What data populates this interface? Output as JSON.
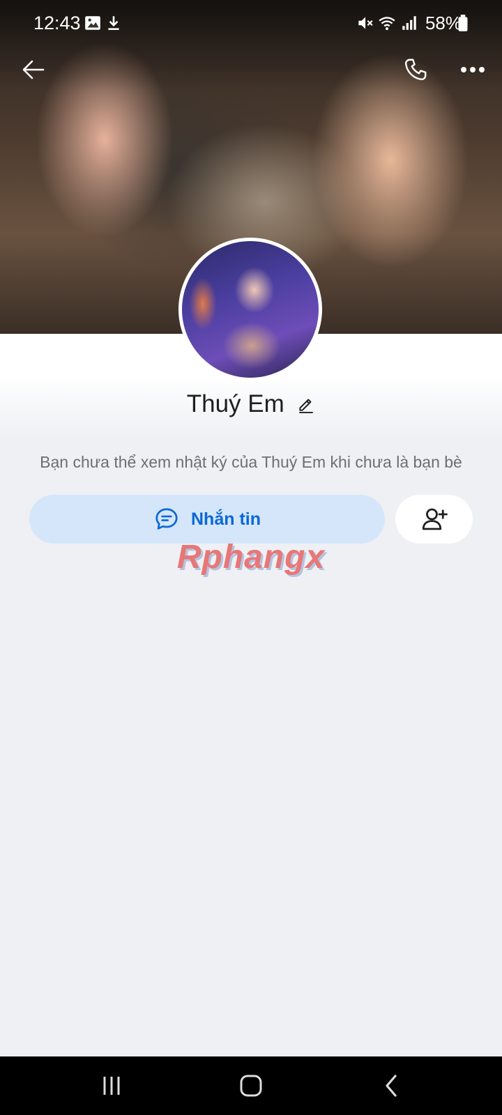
{
  "status": {
    "time": "12:43",
    "battery": "58%",
    "icons": [
      "image-icon",
      "download-icon",
      "mute-icon",
      "wifi-icon",
      "signal-icon",
      "battery-icon"
    ]
  },
  "topbar": {
    "back_icon": "back-arrow-icon",
    "call_icon": "phone-icon",
    "more_icon": "more-dots-icon"
  },
  "profile": {
    "name": "Thuý Em",
    "note": "Bạn chưa thể xem nhật ký của Thuý Em khi chưa là bạn bè"
  },
  "actions": {
    "message_label": "Nhắn tin",
    "message_icon": "chat-bubble-icon",
    "add_friend_icon": "add-friend-icon"
  },
  "watermark": "Rphangx",
  "colors": {
    "accent": "#0a68d6",
    "message_button_bg": "#d5e6fb",
    "page_bg": "#eef0f4"
  }
}
